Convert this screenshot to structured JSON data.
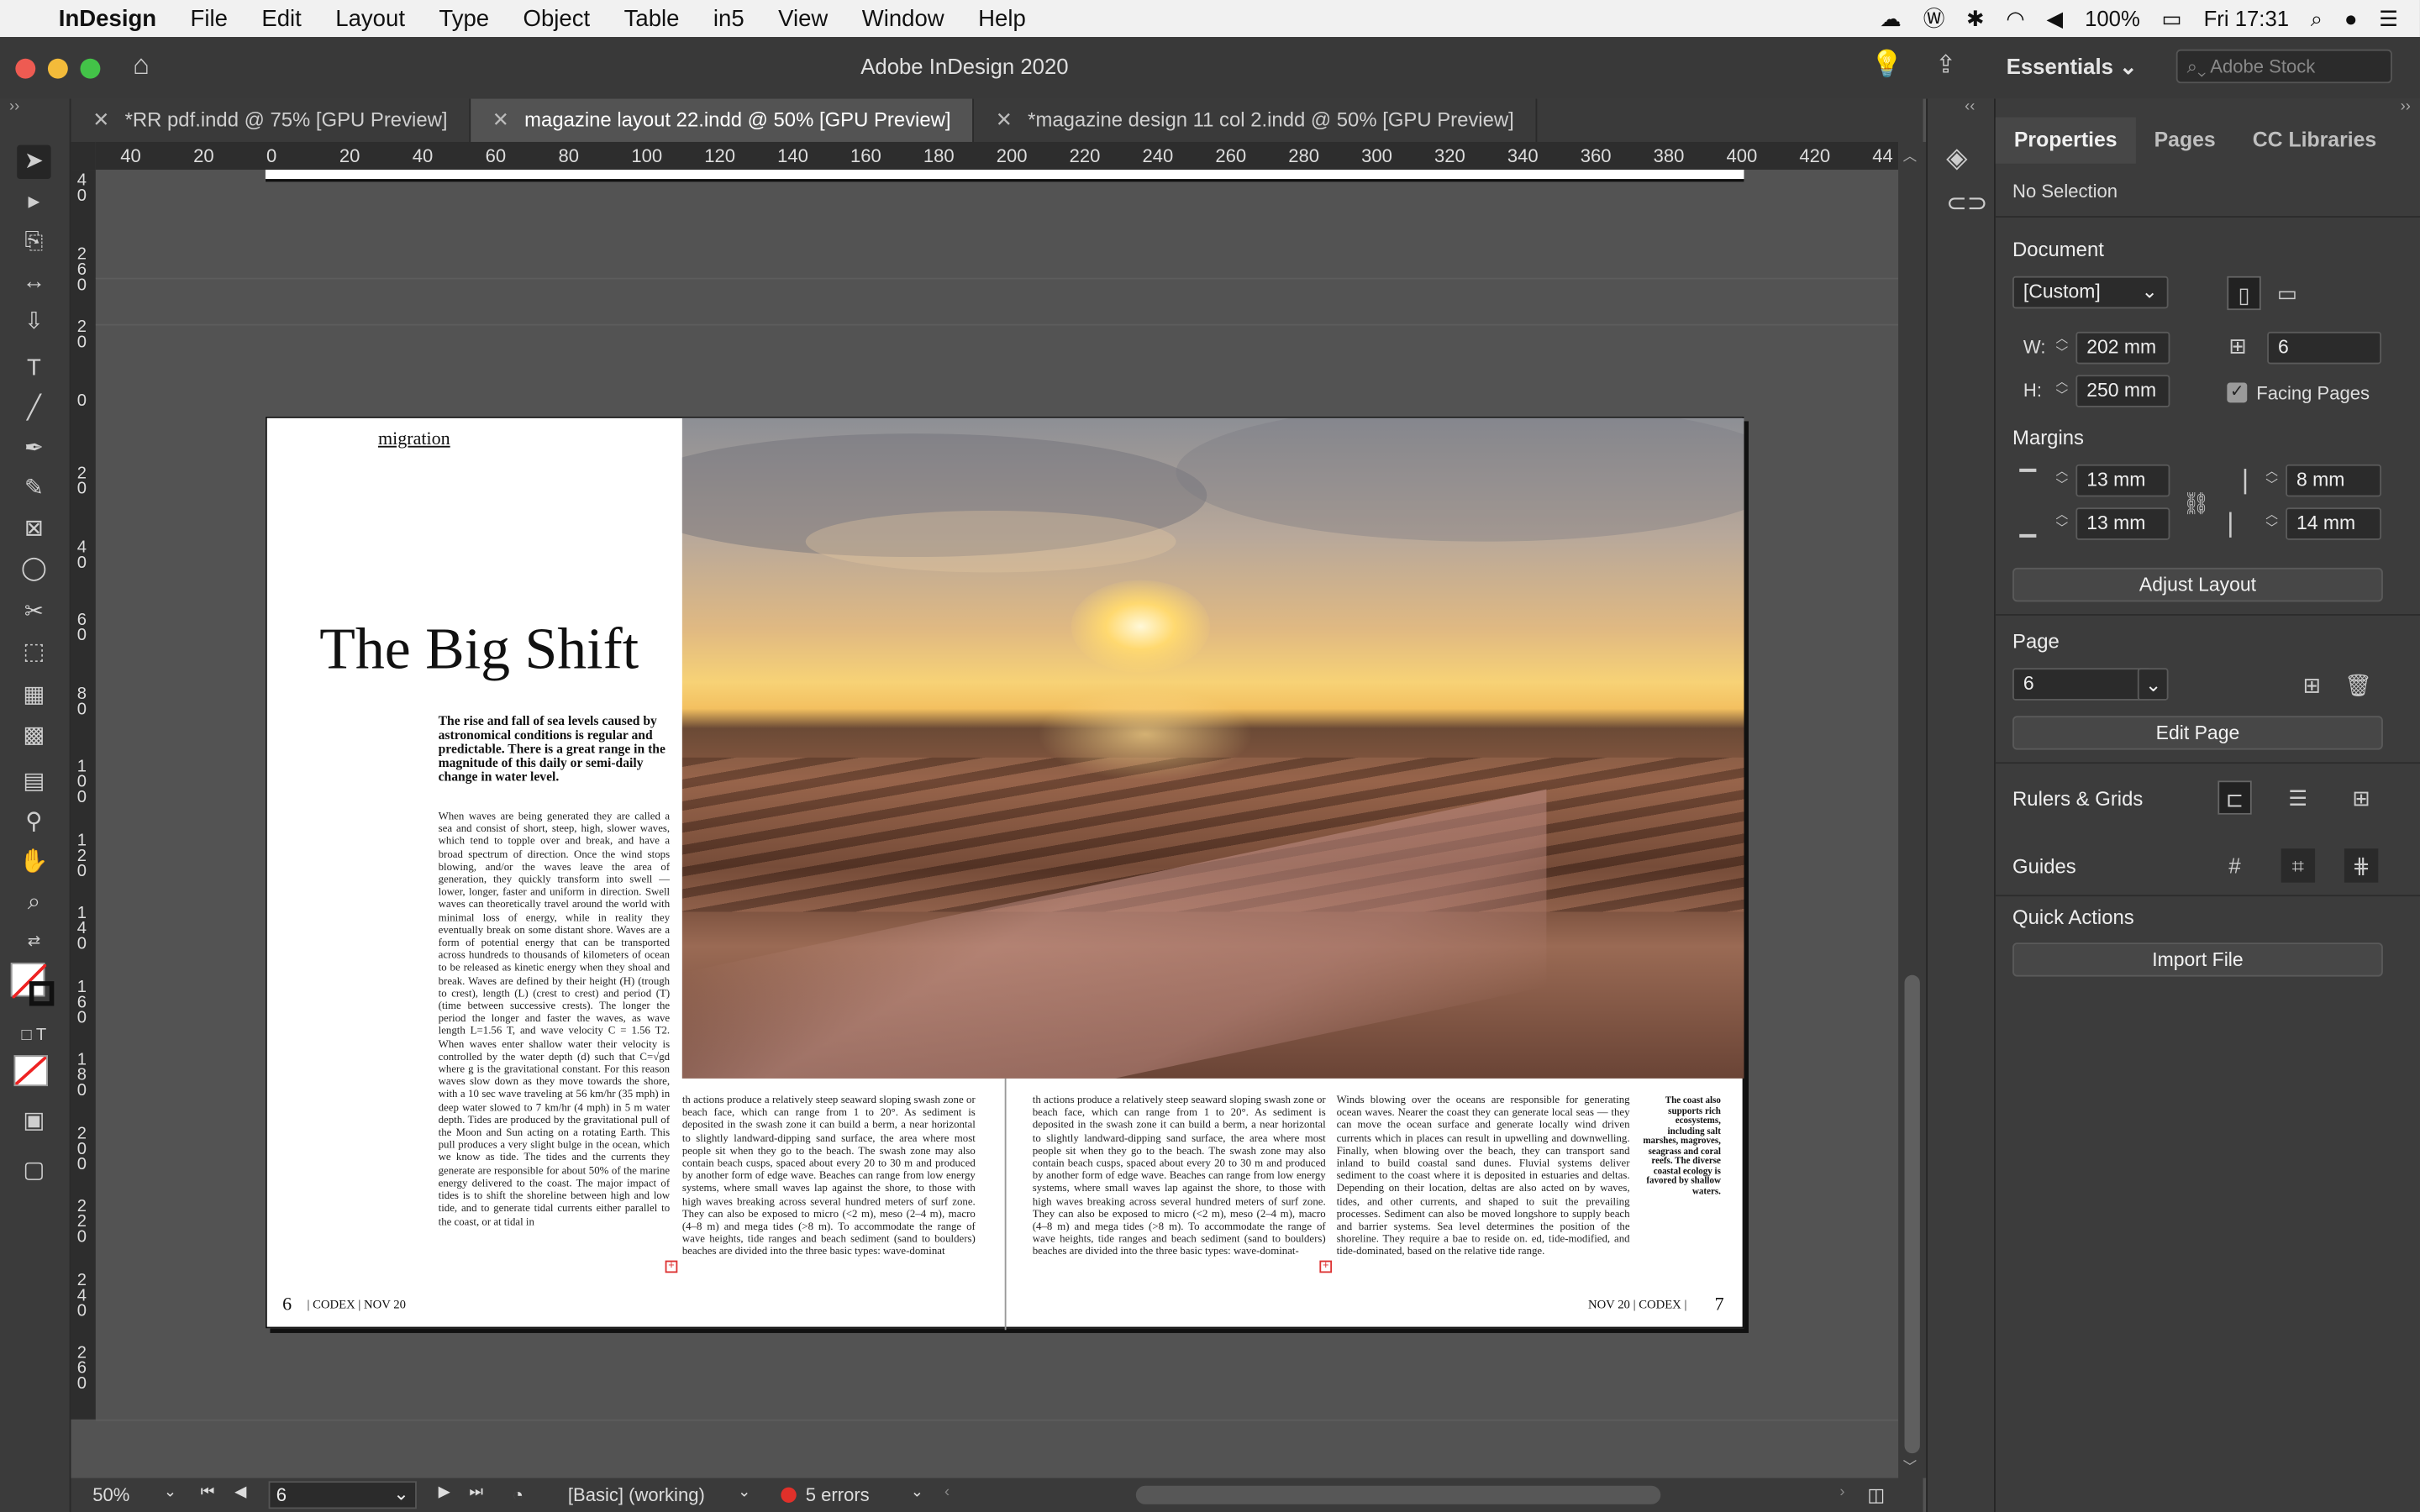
{
  "menubar": {
    "app_name": "InDesign",
    "items": [
      "File",
      "Edit",
      "Layout",
      "Type",
      "Object",
      "Table",
      "in5",
      "View",
      "Window",
      "Help"
    ],
    "battery": "100%",
    "clock": "Fri 17:31"
  },
  "window": {
    "title": "Adobe InDesign 2020",
    "workspace": "Essentials",
    "stock_placeholder": "Adobe Stock"
  },
  "tabs": [
    {
      "label": "*RR pdf.indd @ 75% [GPU Preview]",
      "active": false
    },
    {
      "label": "magazine layout 22.indd @ 50% [GPU Preview]",
      "active": true
    },
    {
      "label": "*magazine design 11 col 2.indd @ 50% [GPU Preview]",
      "active": false
    }
  ],
  "rulers": {
    "horizontal": [
      "40",
      "20",
      "0",
      "20",
      "40",
      "60",
      "80",
      "100",
      "120",
      "140",
      "160",
      "180",
      "200",
      "220",
      "240",
      "260",
      "280",
      "300",
      "320",
      "340",
      "360",
      "380",
      "400",
      "420",
      "44"
    ],
    "vertical": [
      "40",
      "260",
      "20",
      "0",
      "20",
      "40",
      "60",
      "80",
      "100",
      "120",
      "140",
      "160",
      "180",
      "200",
      "220",
      "240",
      "260"
    ]
  },
  "document": {
    "kicker": "migration",
    "headline": "The Big Shift",
    "deck": "The rise and fall of sea levels caused by astronomical conditions is regular and predictable. There is a great range in the magnitude of this daily or semi-daily change in water level.",
    "col1": "When waves are being generated they are called a sea and consist of short, steep, high, slower waves, which tend to topple over and break, and have a broad spectrum of direction. Once the wind stops blowing, and/or the waves leave the area of generation, they quickly transform into swell — lower, longer, faster and uniform in direction. Swell waves can theoretically travel around the world with minimal loss of energy, while in reality they eventually break on some distant shore. Waves are a form of potential energy that can be transported across hundreds to thousands of kilometers of ocean to be released as kinetic energy when they shoal and break. Waves are defined by their height (H) (trough to crest), length (L) (crest to crest) and period (T) (time between successive crests). The longer the period the longer and faster the waves, as wave length L=1.56 T, and wave velocity C = 1.56 T2. When waves enter shallow water their velocity is controlled by the water depth (d) such that C=√gd where g is the gravitational constant. For this reason waves slow down as they move towards the shore, with a 10 sec wave traveling at 56 km/hr (35 mph) in deep water slowed to 7 km/hr (4 mph) in 5 m water depth. Tides are produced by the gravitational pull of the Moon and Sun acting on a rotating Earth. This pull produces a very slight bulge in the ocean, which we know as tide. The tides and the currents they generate are responsible for about 50% of the marine energy delivered to the coast. The major impact of tides is to shift the shoreline between high and low tide, and to generate tidal currents either parallel to the coast, or at tidal in",
    "col2": "th actions produce a relatively steep seaward sloping swash zone or beach face, which can range from 1 to 20°. As sediment is deposited in the swash zone it can build a berm, a near horizontal to slightly landward-dipping sand surface, the area where most people sit when they go to the beach. The swash zone may also contain beach cusps, spaced about every 20 to 30 m and produced by another form of edge wave. Beaches can range from low energy systems, where small waves lap against the shore, to those with high waves breaking across several hundred meters of surf zone. They can also be exposed to micro (<2 m), meso (2–4 m), macro (4–8 m) and mega tides (>8 m). To accommodate the range of wave heights, tide ranges and beach sediment (sand to boulders) beaches are divided into the three basic types: wave-dominat",
    "col3": "th actions produce a relatively steep seaward sloping swash zone or beach face, which can range from 1 to 20°. As sediment is deposited in the swash zone it can build a berm, a near horizontal to slightly landward-dipping sand surface, the area where most people sit when they go to the beach. The swash zone may also contain beach cusps, spaced about every 20 to 30 m and produced by another form of edge wave. Beaches can range from low energy systems, where small waves lap against the shore, to those with high waves breaking across several hundred meters of surf zone. They can also be exposed to micro (<2 m), meso (2–4 m), macro (4–8 m) and mega tides (>8 m). To accommodate the range of wave heights, tide ranges and beach sediment (sand to boulders) beaches are divided into the three basic types: wave-dominat-",
    "col4": "Winds blowing over the oceans are responsible for generating ocean waves. Nearer the coast they can generate local seas — they can move the ocean surface and generate locally wind driven currents which in places can result in upwelling and downwelling. Finally, when blowing over the beach, they can transport sand inland to build coastal sand dunes. Fluvial systems deliver sediment to the coast where it is deposited in estuaries and deltas. Depending on their location, deltas are also acted on by waves, tides, and other currents, and shaped to suit the prevailing processes. Sediment can also be moved longshore to supply beach and barrier systems. Sea level determines the position of the shoreline. They require a bae to reside on. ed, tide-modified, and tide-dominated, based on the relative tide range.",
    "sidebar": "The coast also supports rich ecosystems, including salt marshes, magroves, seagrass and coral reefs. The diverse coastal ecology is favored by shallow waters.",
    "folio_left_num": "6",
    "folio_left_text": "| CODEX | NOV 20",
    "folio_right_num": "7",
    "folio_right_text": "NOV 20 | CODEX |"
  },
  "statusbar": {
    "zoom": "50%",
    "page": "6",
    "style": "[Basic] (working)",
    "errors": "5 errors"
  },
  "properties_panel": {
    "tabs": [
      "Properties",
      "Pages",
      "CC Libraries"
    ],
    "selection": "No Selection",
    "document_label": "Document",
    "preset": "[Custom]",
    "width_label": "W:",
    "width": "202 mm",
    "height_label": "H:",
    "height": "250 mm",
    "pages_count": "6",
    "facing_pages": "Facing Pages",
    "margins_label": "Margins",
    "margin_top": "13 mm",
    "margin_bottom": "13 mm",
    "margin_inside": "8 mm",
    "margin_outside": "14 mm",
    "adjust_layout": "Adjust Layout",
    "page_label": "Page",
    "page_value": "6",
    "edit_page": "Edit Page",
    "rulers_grids": "Rulers & Grids",
    "guides": "Guides",
    "quick_actions": "Quick Actions",
    "import_file": "Import File"
  }
}
